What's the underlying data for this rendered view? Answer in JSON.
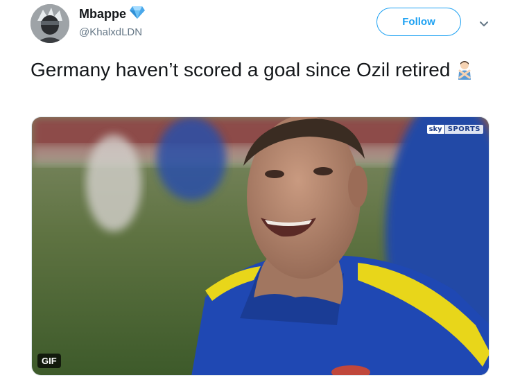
{
  "tweet": {
    "author": {
      "display_name": "Mbappe",
      "handle": "@KhalxdLDN",
      "badge_icon": "diamond-icon",
      "badge_color": "#5ab4f0"
    },
    "follow_label": "Follow",
    "text": "Germany haven’t scored a goal since Ozil retired",
    "trailing_emoji": "man-gesturing-no-icon",
    "media": {
      "type": "gif",
      "badge_label": "GIF",
      "broadcaster_logo": {
        "part1": "sky",
        "part2": "SPORTS"
      }
    }
  },
  "colors": {
    "accent": "#1da1f2",
    "text_primary": "#14171a",
    "text_secondary": "#657786"
  }
}
